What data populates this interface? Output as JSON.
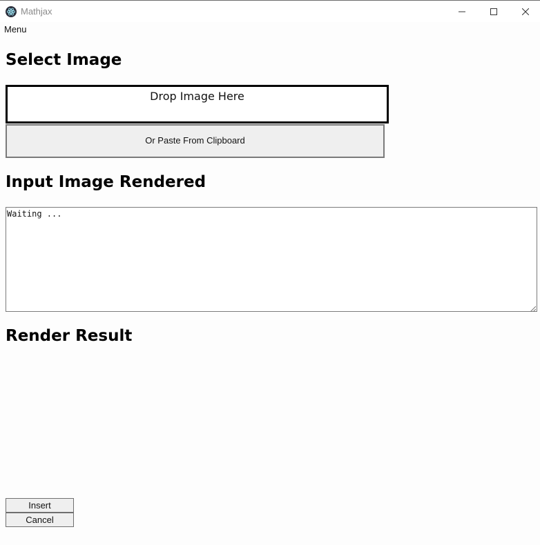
{
  "window": {
    "title": "Mathjax",
    "icon": "electron-atom-icon",
    "controls": [
      "minimize-icon",
      "maximize-icon",
      "close-icon"
    ]
  },
  "menubar": {
    "menu_label": "Menu"
  },
  "select_image": {
    "heading": "Select Image",
    "dropzone_label": "Drop Image Here",
    "paste_button_label": "Or Paste From Clipboard"
  },
  "input_rendered": {
    "heading": "Input Image Rendered",
    "textarea_value": "Waiting ..."
  },
  "render_result": {
    "heading": "Render Result"
  },
  "actions": {
    "insert_label": "Insert",
    "cancel_label": "Cancel"
  }
}
